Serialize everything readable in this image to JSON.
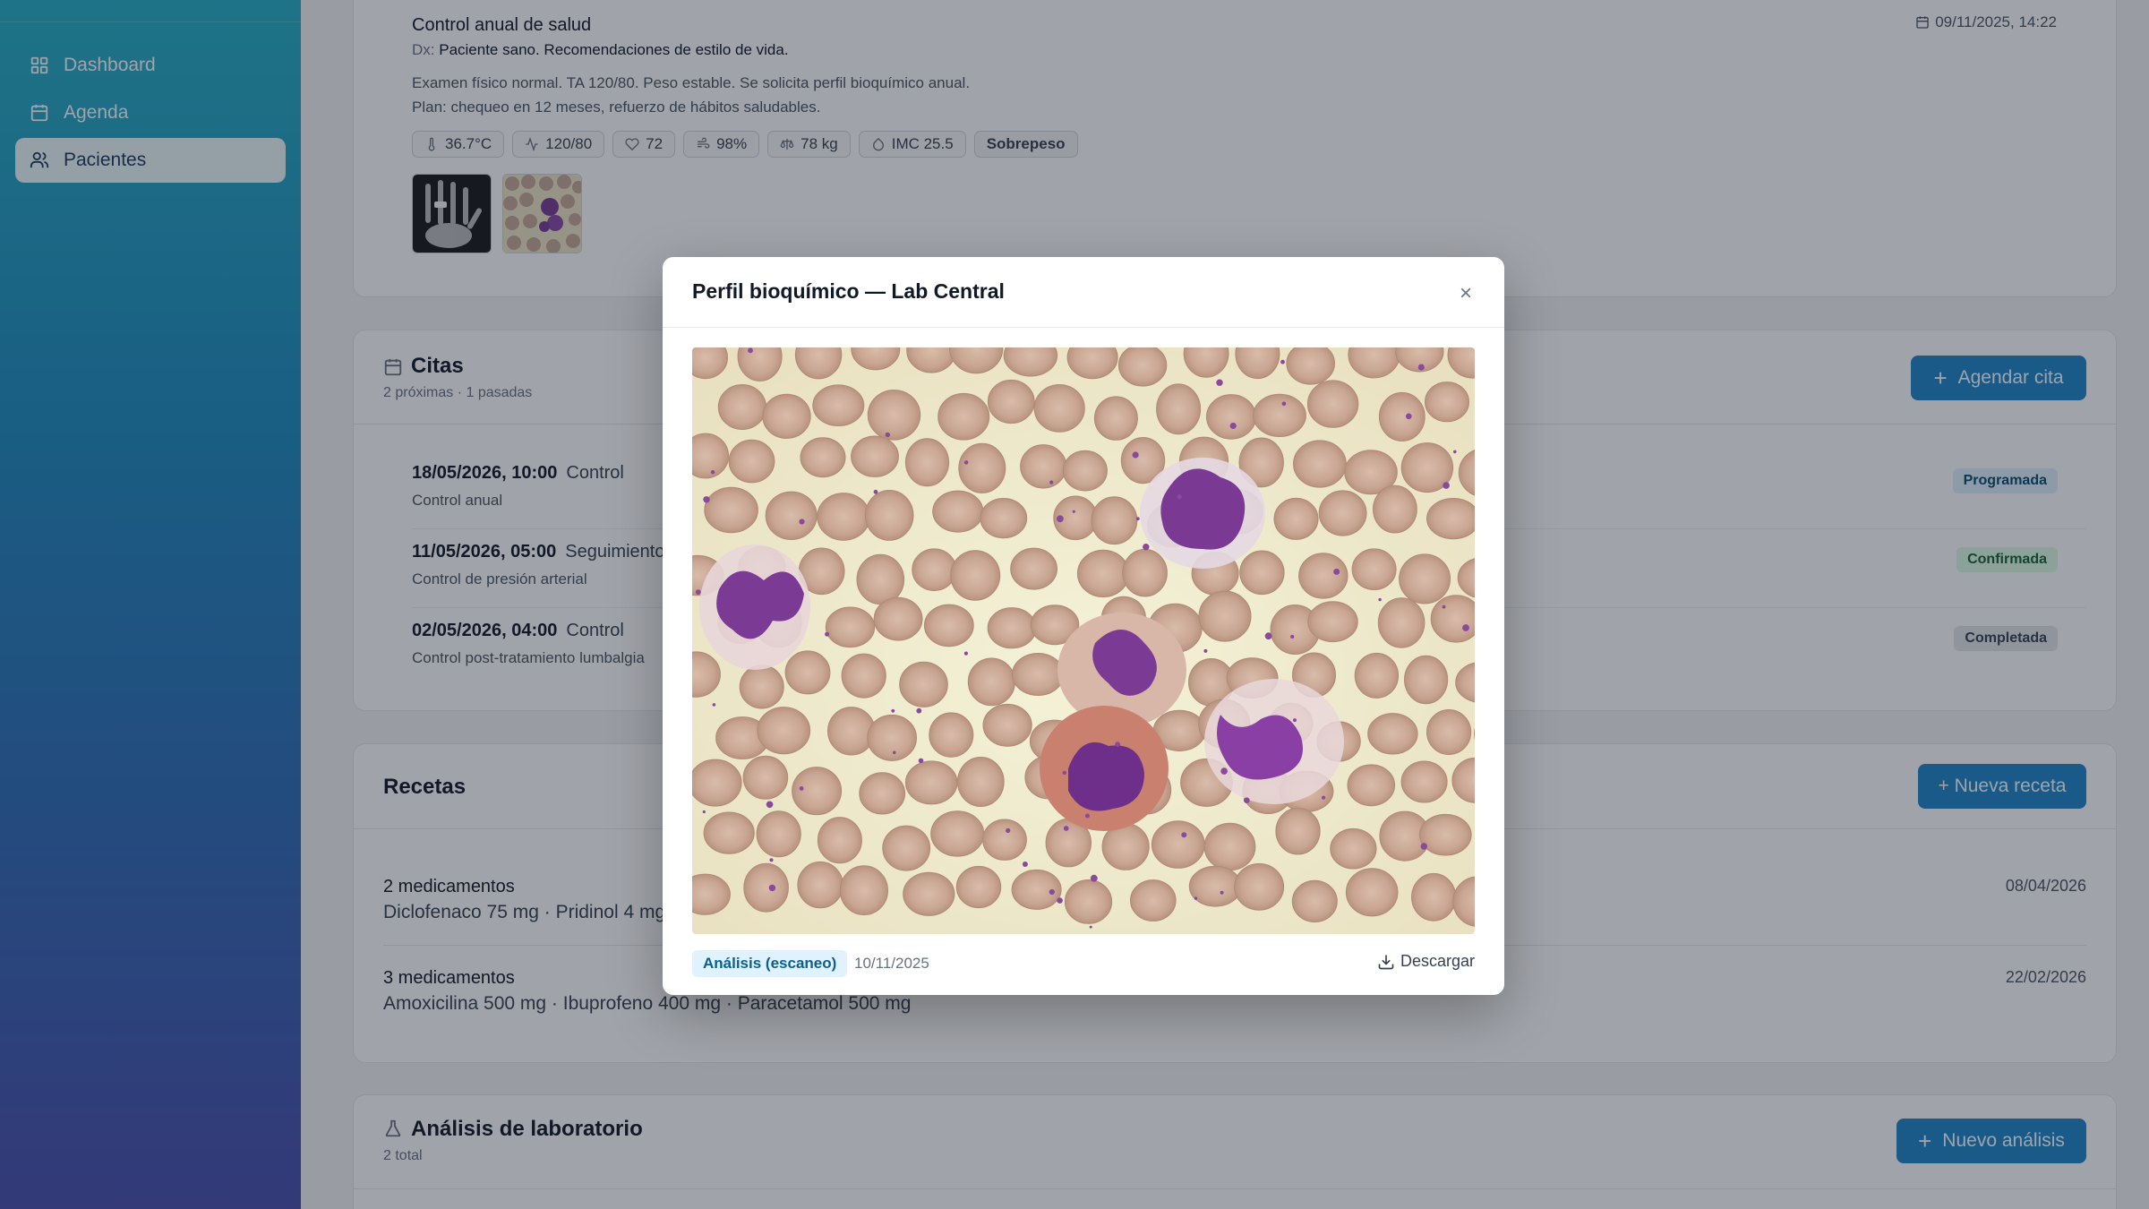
{
  "sidebar": {
    "items": [
      {
        "label": "Dashboard",
        "icon": "grid-icon"
      },
      {
        "label": "Agenda",
        "icon": "calendar-icon"
      },
      {
        "label": "Pacientes",
        "icon": "users-icon",
        "active": true
      }
    ]
  },
  "note": {
    "title": "Control anual de salud",
    "date": "09/11/2025, 14:22",
    "dx_label": "Dx:",
    "dx_value": "Paciente sano. Recomendaciones de estilo de vida.",
    "line1": "Examen físico normal. TA 120/80. Peso estable. Se solicita perfil bioquímico anual.",
    "line2": "Plan: chequeo en 12 meses, refuerzo de hábitos saludables.",
    "vitals": [
      {
        "icon": "thermometer-icon",
        "value": "36.7°C"
      },
      {
        "icon": "pulse-icon",
        "value": "120/80"
      },
      {
        "icon": "heart-icon",
        "value": "72"
      },
      {
        "icon": "lungs-icon",
        "value": "98%"
      },
      {
        "icon": "scale-icon",
        "value": "78 kg"
      },
      {
        "icon": "drop-icon",
        "value": "IMC 25.5"
      },
      {
        "icon": "",
        "value": "Sobrepeso"
      }
    ]
  },
  "citas": {
    "title": "Citas",
    "subtitle": "2 próximas · 1 pasadas",
    "button": "Agendar cita",
    "items": [
      {
        "when": "18/05/2026, 10:00",
        "type": "Control",
        "desc": "Control anual",
        "status": "Programada"
      },
      {
        "when": "11/05/2026, 05:00",
        "type": "Seguimiento",
        "desc": "Control de presión arterial",
        "status": "Confirmada"
      },
      {
        "when": "02/05/2026, 04:00",
        "type": "Control",
        "desc": "Control post-tratamiento lumbalgia",
        "status": "Completada"
      }
    ]
  },
  "recetas": {
    "title": "Recetas",
    "button": "+ Nueva receta",
    "items": [
      {
        "count": "2 medicamentos",
        "meds": "Diclofenaco 75 mg · Pridinol 4 mg",
        "date": "08/04/2026"
      },
      {
        "count": "3 medicamentos",
        "meds": "Amoxicilina 500 mg · Ibuprofeno 400 mg · Paracetamol 500 mg",
        "date": "22/02/2026"
      }
    ]
  },
  "analisis": {
    "title": "Análisis de laboratorio",
    "subtitle": "2 total",
    "button": "Nuevo análisis"
  },
  "modal": {
    "title": "Perfil bioquímico — Lab Central",
    "close": "×",
    "type": "Análisis (escaneo)",
    "date": "10/11/2025",
    "download": "Descargar"
  },
  "colors": {
    "accent": "#1e86c8",
    "sidebar_top": "#27b0c6",
    "sidebar_bottom": "#4b4fae",
    "cell_background": "#f2edd3",
    "rbc": "#c9a897",
    "nucleus": "#7a3f95"
  }
}
